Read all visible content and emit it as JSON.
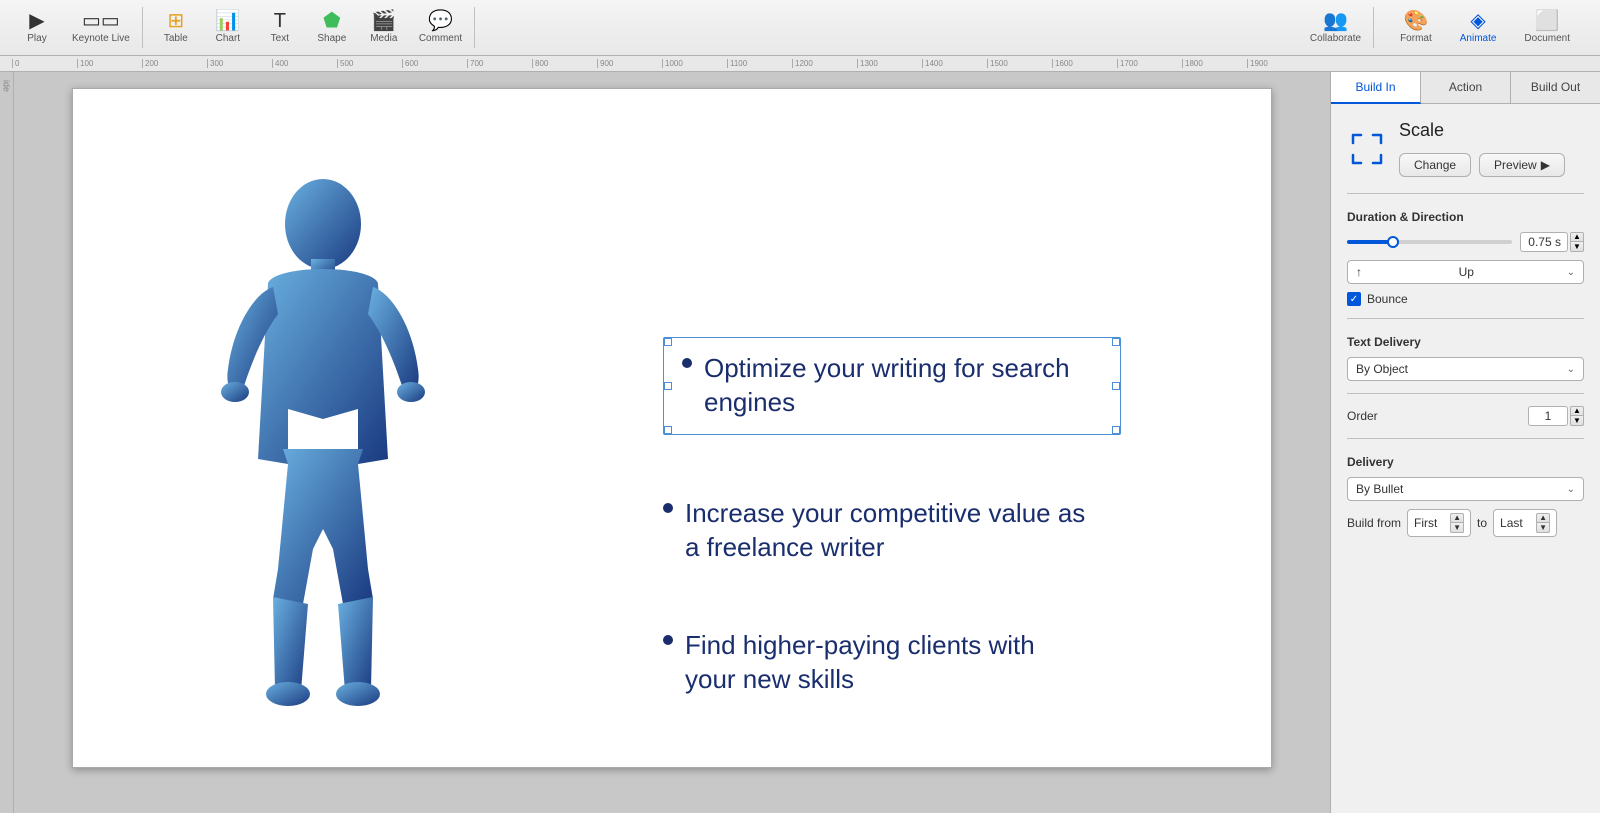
{
  "toolbar": {
    "play_label": "Play",
    "keynote_live_label": "Keynote Live",
    "table_label": "Table",
    "chart_label": "Chart",
    "text_label": "Text",
    "shape_label": "Shape",
    "media_label": "Media",
    "comment_label": "Comment",
    "collaborate_label": "Collaborate",
    "format_label": "Format",
    "animate_label": "Animate",
    "document_label": "Document"
  },
  "ruler": {
    "marks": [
      "0",
      "100",
      "200",
      "300",
      "400",
      "500",
      "600",
      "700",
      "800",
      "900",
      "1000",
      "1100",
      "1200",
      "1300",
      "1400",
      "1500",
      "1600",
      "1700",
      "1800",
      "1900"
    ]
  },
  "slide": {
    "bullet1": "Optimize your writing for search engines",
    "bullet2": "Increase your competitive value as a freelance writer",
    "bullet3": "Find higher-paying clients with your new skills"
  },
  "right_panel": {
    "build_in_tab": "Build In",
    "action_tab": "Action",
    "build_out_tab": "Build Out",
    "scale_title": "Scale",
    "change_btn": "Change",
    "preview_btn": "Preview",
    "preview_arrow": "▶",
    "duration_direction_label": "Duration & Direction",
    "duration_value": "0.75 s",
    "direction_label": "Up",
    "direction_icon": "↑",
    "bounce_label": "Bounce",
    "text_delivery_label": "Text Delivery",
    "text_delivery_value": "By Object",
    "order_label": "Order",
    "order_value": "1",
    "delivery_label": "Delivery",
    "delivery_value": "By Bullet",
    "build_from_label": "Build from",
    "build_from_first": "First",
    "to_label": "to",
    "build_from_last": "Last"
  }
}
